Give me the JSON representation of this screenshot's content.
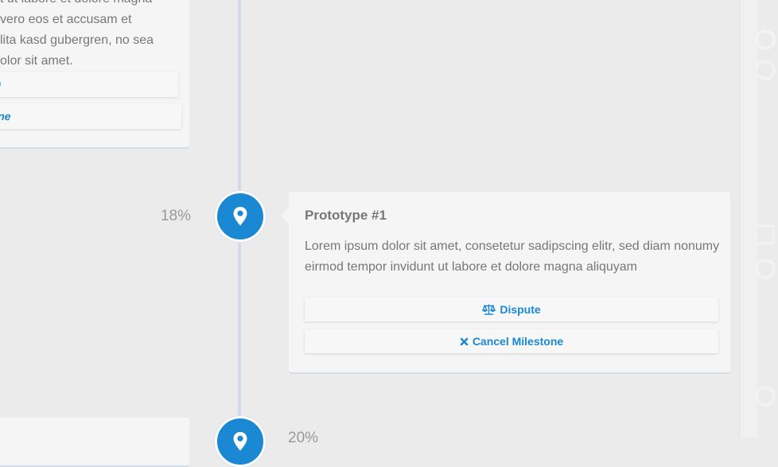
{
  "previous_milestone": {
    "description_fragment": "t ut labore et dolore magna\n vero eos et accusam et\nlita kasd gubergren, no sea\nolor sit amet.",
    "cancel_label_fragment": "tone"
  },
  "current_milestone": {
    "percent": "18%",
    "title": "Prototype #1",
    "description": "Lorem ipsum dolor sit amet, consetetur sadipscing elitr, sed diam nonumy eirmod tempor invidunt ut labore et dolore magna aliquyam",
    "dispute_label": "Dispute",
    "cancel_label": "Cancel Milestone"
  },
  "next_milestone": {
    "percent": "20%"
  },
  "colors": {
    "accent": "#1a88d3",
    "timeline": "#cfdbe6",
    "card": "#f5f5f5",
    "background": "#ebebeb"
  },
  "icons": {
    "node": "map-marker-icon",
    "dispute": "scale-icon",
    "cancel": "close-icon"
  }
}
